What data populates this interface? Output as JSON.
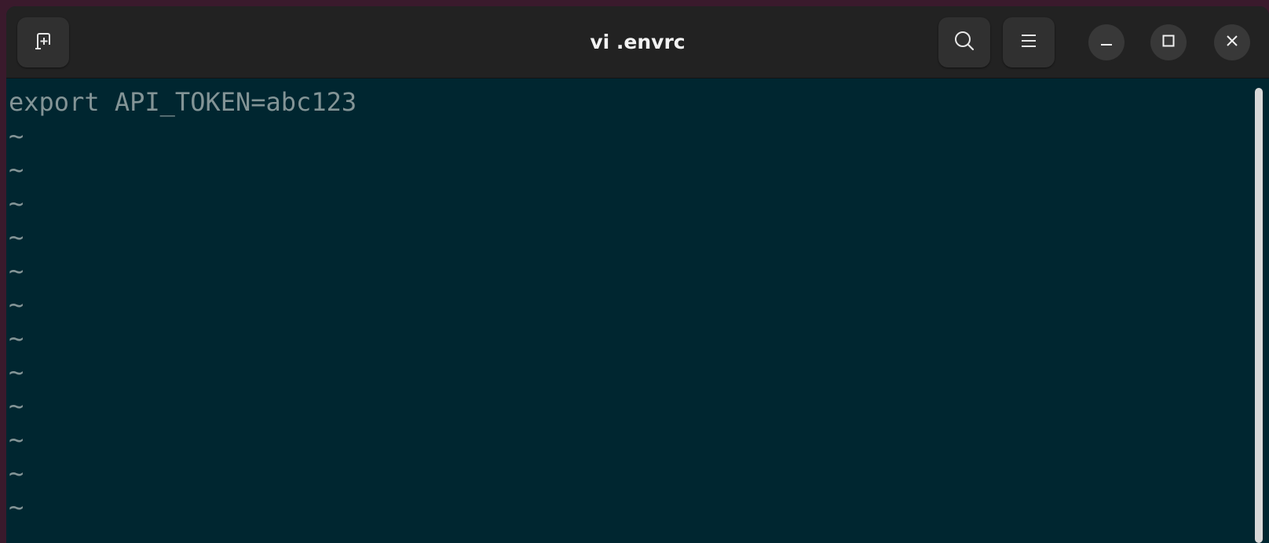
{
  "window": {
    "title": "vi .envrc"
  },
  "titlebar": {
    "new_tab_icon": "new-tab-icon",
    "search_icon": "search-icon",
    "menu_icon": "hamburger-menu-icon",
    "minimize_icon": "minimize-icon",
    "maximize_icon": "maximize-icon",
    "close_icon": "close-icon"
  },
  "colors": {
    "terminal_bg": "#002630",
    "text": "#839496",
    "titlebar_bg": "#222222"
  },
  "editor": {
    "lines": [
      "export API_TOKEN=abc123",
      "~",
      "~",
      "~",
      "~",
      "~",
      "~",
      "~",
      "~",
      "~",
      "~",
      "~",
      "~"
    ]
  }
}
